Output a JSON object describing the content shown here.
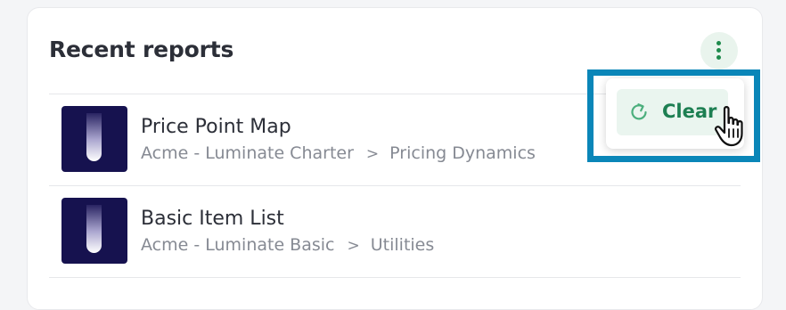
{
  "card": {
    "title": "Recent reports"
  },
  "reports": [
    {
      "title": "Price Point Map",
      "crumb_source": "Acme - Luminate Charter",
      "crumb_separator": ">",
      "crumb_target": "Pricing Dynamics"
    },
    {
      "title": "Basic Item List",
      "crumb_source": "Acme - Luminate Basic",
      "crumb_separator": ">",
      "crumb_target": "Utilities"
    }
  ],
  "menu": {
    "clear_label": "Clear"
  },
  "icons": {
    "more": "kebab-menu-icon",
    "refresh": "refresh-icon",
    "cursor": "hand-pointer-icon",
    "thumbnail": "report-thumbnail-icon"
  },
  "colors": {
    "accent_green": "#1d7f52",
    "accent_green_bg": "#eaf5ef",
    "thumbnail_bg": "#16124f",
    "highlight_border": "#0a86b8",
    "text_primary": "#2c2f38",
    "text_secondary": "#868a93"
  }
}
